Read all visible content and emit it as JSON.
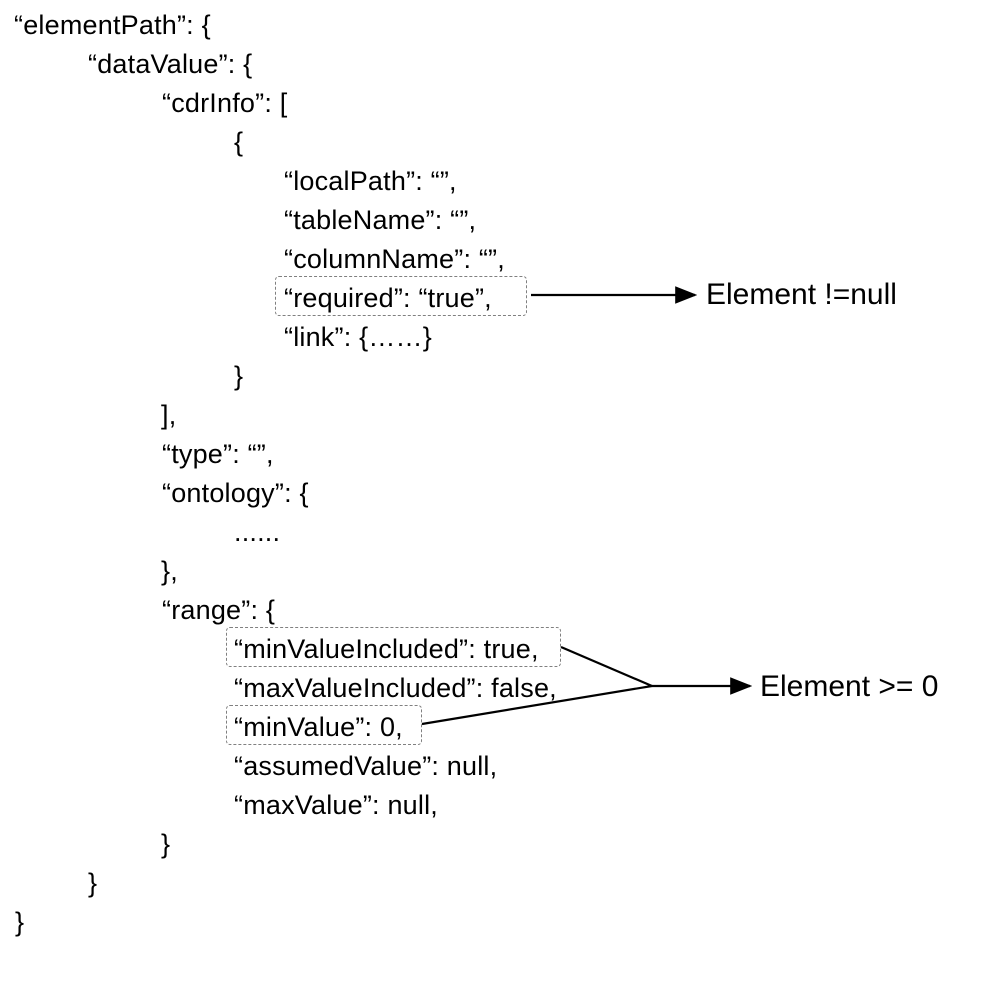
{
  "lines": {
    "l01": "“elementPath”: {",
    "l02": "“dataValue”: {",
    "l03": "“cdrInfo”: [",
    "l04": "{",
    "l05": "“localPath”: “”,",
    "l06": "“tableName”: “”,",
    "l07": "“columnName”: “”,",
    "l08": "“required”: “true”,",
    "l09": "“link”: {……}",
    "l10": "}",
    "l11": "],",
    "l12": "“type”: “”,",
    "l13": "“ontology”: {",
    "l14": "......",
    "l15": "},",
    "l16": "“range”: {",
    "l17": "“minValueIncluded”: true,",
    "l18": "“maxValueIncluded”: false,",
    "l19": "“minValue”: 0,",
    "l20": "“assumedValue”: null,",
    "l21": "“maxValue”: null,",
    "l22": "}",
    "l23": "}",
    "l24": "}"
  },
  "annotations": {
    "a1": "Element !=null",
    "a2": "Element >= 0"
  }
}
